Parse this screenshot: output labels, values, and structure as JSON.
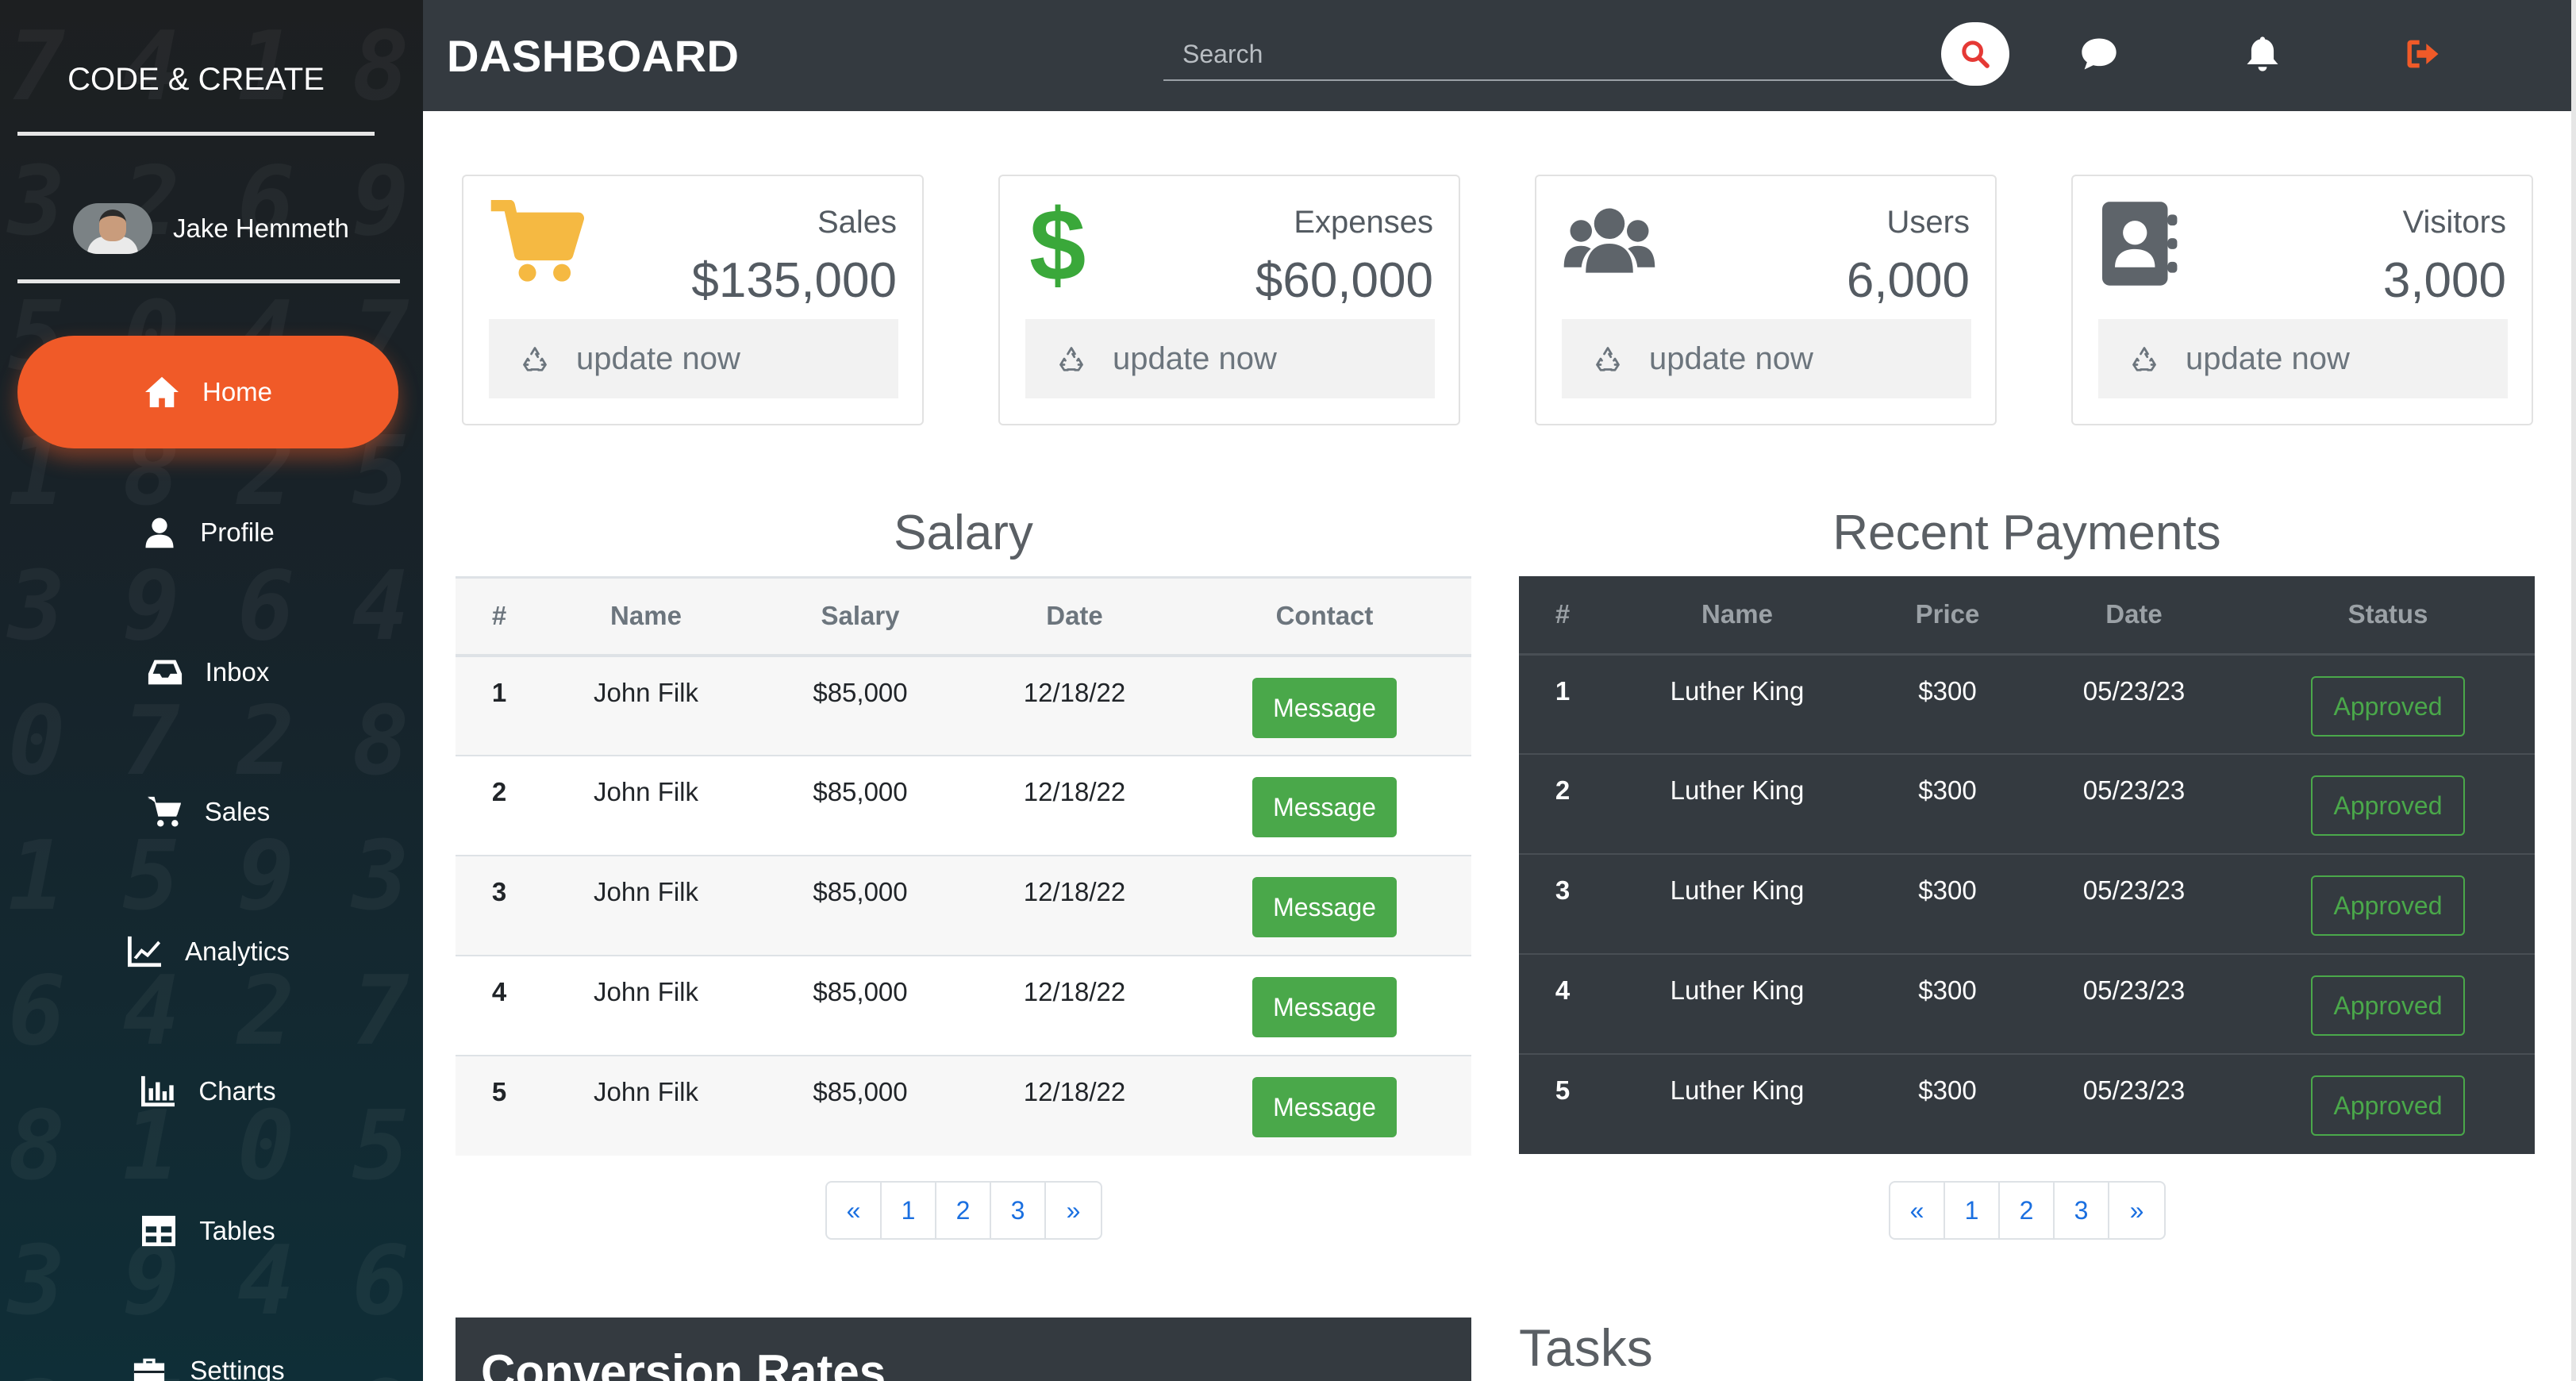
{
  "sidebar": {
    "brand": "CODE & CREATE",
    "user_name": "Jake Hemmeth",
    "items": [
      {
        "label": "Home",
        "icon": "home-icon"
      },
      {
        "label": "Profile",
        "icon": "user-icon"
      },
      {
        "label": "Inbox",
        "icon": "inbox-icon"
      },
      {
        "label": "Sales",
        "icon": "cart-icon"
      },
      {
        "label": "Analytics",
        "icon": "line-chart-icon"
      },
      {
        "label": "Charts",
        "icon": "bar-chart-icon"
      },
      {
        "label": "Tables",
        "icon": "table-icon"
      },
      {
        "label": "Settings",
        "icon": "toolbox-icon"
      }
    ]
  },
  "topbar": {
    "title": "DASHBOARD",
    "search_placeholder": "Search",
    "icons": [
      "search-icon",
      "chat-icon",
      "bell-icon",
      "logout-icon"
    ]
  },
  "colors": {
    "accent": "#f05a28",
    "topbar": "#343a40",
    "success": "#4aa84a",
    "sales_icon": "#f5b942",
    "expenses_icon": "#3aa83a",
    "users_icon": "#5e646a"
  },
  "cards": [
    {
      "label": "Sales",
      "value": "$135,000",
      "update": "update now",
      "icon": "cart-icon"
    },
    {
      "label": "Expenses",
      "value": "$60,000",
      "update": "update now",
      "icon": "dollar-icon"
    },
    {
      "label": "Users",
      "value": "6,000",
      "update": "update now",
      "icon": "users-icon"
    },
    {
      "label": "Visitors",
      "value": "3,000",
      "update": "update now",
      "icon": "address-book-icon"
    }
  ],
  "salary": {
    "title": "Salary",
    "headers": [
      "#",
      "Name",
      "Salary",
      "Date",
      "Contact"
    ],
    "rows": [
      {
        "num": "1",
        "name": "John Filk",
        "salary": "$85,000",
        "date": "12/18/22",
        "action": "Message"
      },
      {
        "num": "2",
        "name": "John Filk",
        "salary": "$85,000",
        "date": "12/18/22",
        "action": "Message"
      },
      {
        "num": "3",
        "name": "John Filk",
        "salary": "$85,000",
        "date": "12/18/22",
        "action": "Message"
      },
      {
        "num": "4",
        "name": "John Filk",
        "salary": "$85,000",
        "date": "12/18/22",
        "action": "Message"
      },
      {
        "num": "5",
        "name": "John Filk",
        "salary": "$85,000",
        "date": "12/18/22",
        "action": "Message"
      }
    ],
    "pagination": [
      "«",
      "1",
      "2",
      "3",
      "»"
    ]
  },
  "payments": {
    "title": "Recent Payments",
    "headers": [
      "#",
      "Name",
      "Price",
      "Date",
      "Status"
    ],
    "rows": [
      {
        "num": "1",
        "name": "Luther King",
        "price": "$300",
        "date": "05/23/23",
        "status": "Approved"
      },
      {
        "num": "2",
        "name": "Luther King",
        "price": "$300",
        "date": "05/23/23",
        "status": "Approved"
      },
      {
        "num": "3",
        "name": "Luther King",
        "price": "$300",
        "date": "05/23/23",
        "status": "Approved"
      },
      {
        "num": "4",
        "name": "Luther King",
        "price": "$300",
        "date": "05/23/23",
        "status": "Approved"
      },
      {
        "num": "5",
        "name": "Luther King",
        "price": "$300",
        "date": "05/23/23",
        "status": "Approved"
      }
    ],
    "pagination": [
      "«",
      "1",
      "2",
      "3",
      "»"
    ]
  },
  "conversion": {
    "title": "Conversion Rates"
  },
  "tasks": {
    "title": "Tasks"
  }
}
